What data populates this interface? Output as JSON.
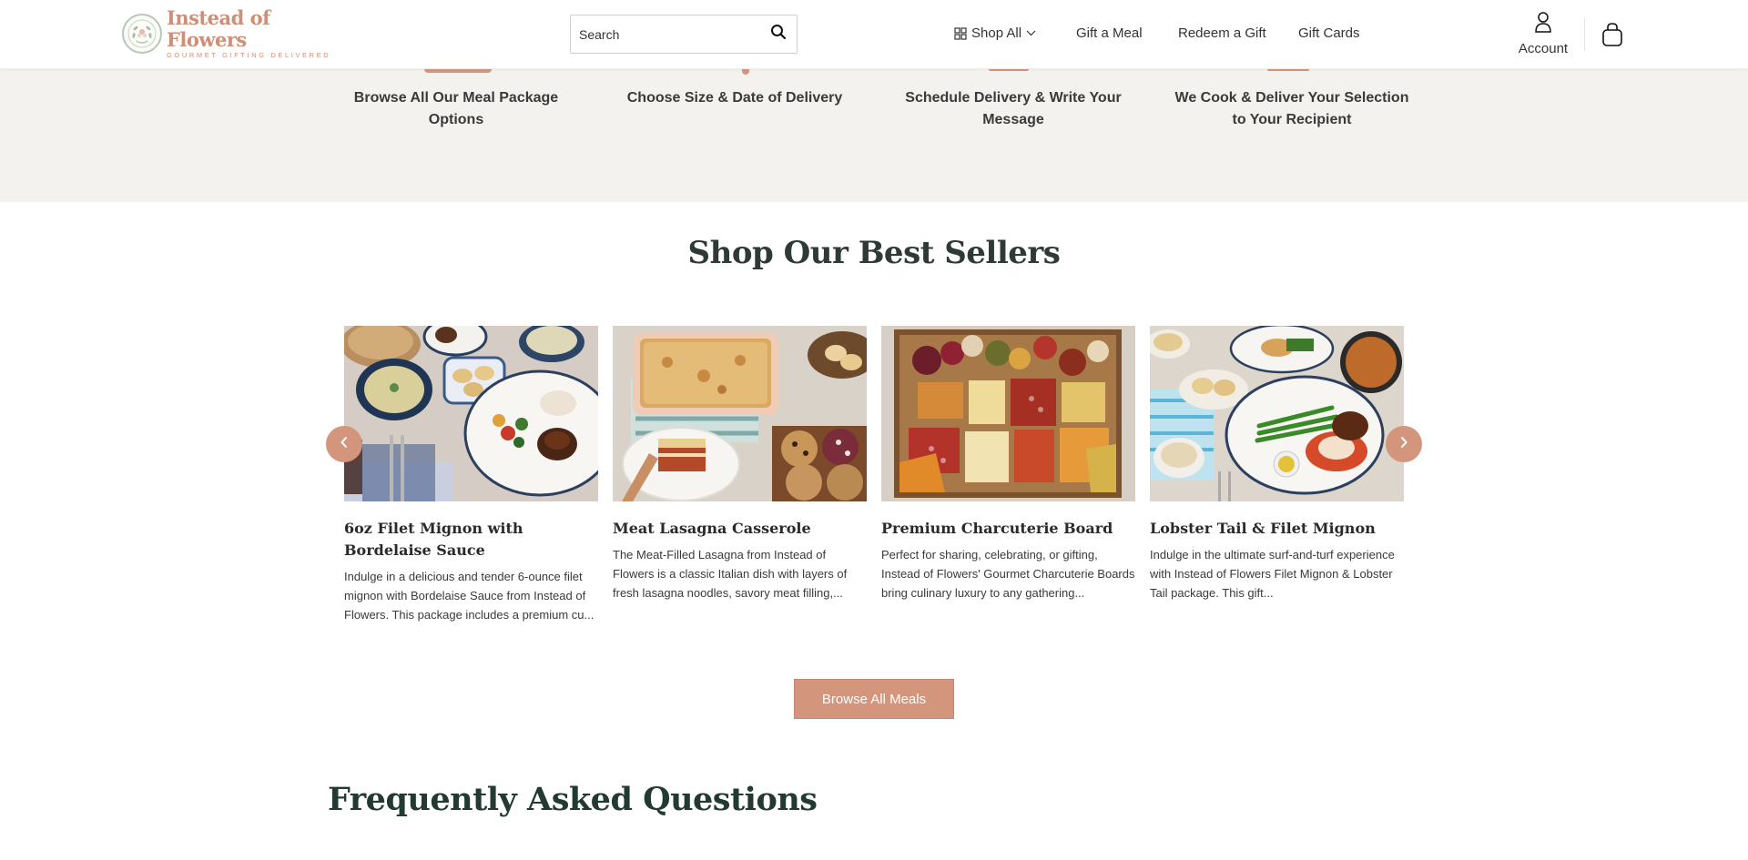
{
  "header": {
    "logo": {
      "title": "Instead of Flowers",
      "subtitle": "GOURMET GIFTING DELIVERED"
    },
    "search": {
      "placeholder": "Search",
      "value": ""
    },
    "nav": [
      {
        "label": "Shop All",
        "icon": "grid-icon",
        "dropdown": true
      },
      {
        "label": "Gift a Meal"
      },
      {
        "label": "Redeem a Gift"
      },
      {
        "label": "Gift Cards"
      }
    ],
    "account_label": "Account",
    "cart_icon": "shopping-bag-icon"
  },
  "steps": [
    {
      "label": "Browse All Our Meal Package Options"
    },
    {
      "label": "Choose Size & Date of Delivery"
    },
    {
      "label": "Schedule Delivery & Write Your Message"
    },
    {
      "label": "We Cook & Deliver Your Selection to Your Recipient"
    }
  ],
  "best_sellers": {
    "title": "Shop Our Best Sellers",
    "products": [
      {
        "title": "6oz Filet Mignon with Bordelaise Sauce",
        "description": "Indulge in a delicious and tender 6-ounce filet mignon with Bordelaise Sauce from Instead of Flowers. This package includes a premium cu..."
      },
      {
        "title": "Meat Lasagna Casserole",
        "description": "The Meat-Filled Lasagna from Instead of Flowers is a classic Italian dish with layers of fresh lasagna noodles, savory meat filling,..."
      },
      {
        "title": "Premium Charcuterie Board",
        "description": "Perfect for sharing, celebrating, or gifting, Instead of Flowers' Gourmet Charcuterie Boards bring culinary luxury to any gathering..."
      },
      {
        "title": "Lobster Tail & Filet Mignon",
        "description": "Indulge in the ultimate surf-and-turf experience with Instead of Flowers Filet Mignon & Lobster Tail package. This gift..."
      }
    ],
    "browse_label": "Browse All Meals"
  },
  "faq": {
    "title": "Frequently Asked Questions"
  },
  "colors": {
    "accent": "#d4957d",
    "band": "#f3f2ee",
    "heading": "#2f3a37"
  }
}
